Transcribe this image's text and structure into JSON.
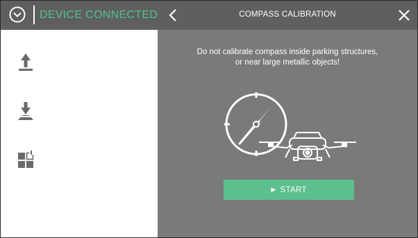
{
  "status_bar": {
    "connection_status": "DEVICE CONNECTED",
    "status_color": "#52c08e"
  },
  "sidebar": {
    "items": [
      {
        "icon": "takeoff-icon"
      },
      {
        "icon": "landing-icon"
      },
      {
        "icon": "grid-icon"
      }
    ]
  },
  "dialog": {
    "title": "COMPASS CALIBRATION",
    "back_icon": "chevron-left-icon",
    "close_icon": "close-icon",
    "warning_line1": "Do not calibrate compass inside parking structures,",
    "warning_line2": "or near large metallic objects!",
    "start_label": "START",
    "start_icon": "play-icon",
    "accent_color": "#5cbf8e"
  }
}
